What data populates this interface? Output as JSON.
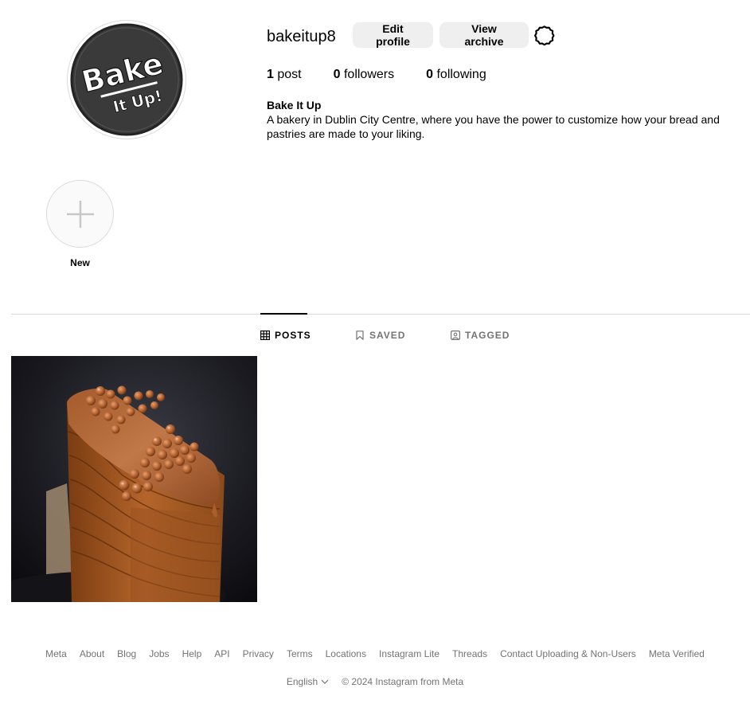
{
  "profile": {
    "username": "bakeitup8",
    "edit_label": "Edit profile",
    "archive_label": "View archive",
    "stats": [
      {
        "count": "1",
        "label": "post"
      },
      {
        "count": "0",
        "label": "followers"
      },
      {
        "count": "0",
        "label": "following"
      }
    ],
    "display_name": "Bake It Up",
    "bio": "A bakery in Dublin City Centre, where you have the power to customize how your bread and pastries are made to your liking.",
    "logo_text": [
      "Bake",
      "It Up!"
    ]
  },
  "highlights": {
    "new_label": "New"
  },
  "tabs": [
    {
      "label": "POSTS",
      "active": true,
      "icon": "grid-icon"
    },
    {
      "label": "SAVED",
      "active": false,
      "icon": "bookmark-icon"
    },
    {
      "label": "TAGGED",
      "active": false,
      "icon": "tagged-icon"
    }
  ],
  "posts": [
    {
      "subject": "layered caramel chocolate cake slice with crispy pearls"
    }
  ],
  "footer": {
    "links": [
      "Meta",
      "About",
      "Blog",
      "Jobs",
      "Help",
      "API",
      "Privacy",
      "Terms",
      "Locations",
      "Instagram Lite",
      "Threads",
      "Contact Uploading & Non-Users",
      "Meta Verified"
    ],
    "language": "English",
    "copyright": "© 2024 Instagram from Meta"
  },
  "colors": {
    "button_bg": "#efefef",
    "muted_text": "#737373",
    "divider": "#dbdbdb",
    "logo_bg": "#3a3a3a"
  }
}
